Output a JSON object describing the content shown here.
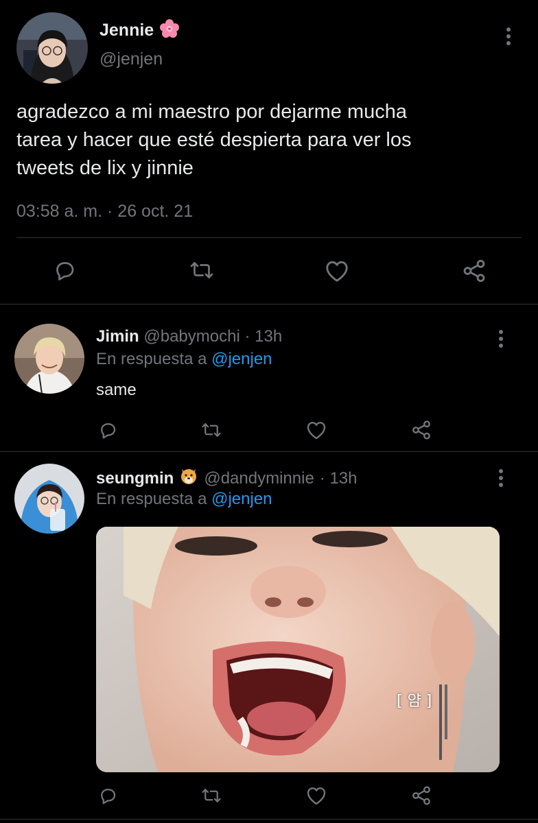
{
  "main_tweet": {
    "name": "Jennie",
    "name_emoji_icon": "cherry-blossom-icon",
    "handle": "@jenjen",
    "text_lines": [
      "agradezco a mi maestro por dejarme mucha",
      "tarea y hacer que esté despierta para ver los",
      "tweets de lix y jinnie"
    ],
    "timestamp": "03:58 a. m. · 26 oct. 21"
  },
  "actions": [
    "reply-icon",
    "retweet-icon",
    "like-icon",
    "share-icon"
  ],
  "replies": [
    {
      "name": "Jimin",
      "handle": "@babymochi",
      "time": "· 13h",
      "reply_prefix": "En respuesta a",
      "reply_to": "@jenjen",
      "text": "same"
    },
    {
      "name": "seungmin",
      "name_emoji_icon": "dog-face-icon",
      "handle": "@dandyminnie",
      "time": "· 13h",
      "reply_prefix": "En respuesta a",
      "reply_to": "@jenjen",
      "media_caption": "[ 얌 ]"
    }
  ],
  "colors": {
    "background": "#000000",
    "text": "#e7e9ea",
    "secondary": "#71767b",
    "link": "#1d9bf0",
    "divider": "#2f3336"
  }
}
